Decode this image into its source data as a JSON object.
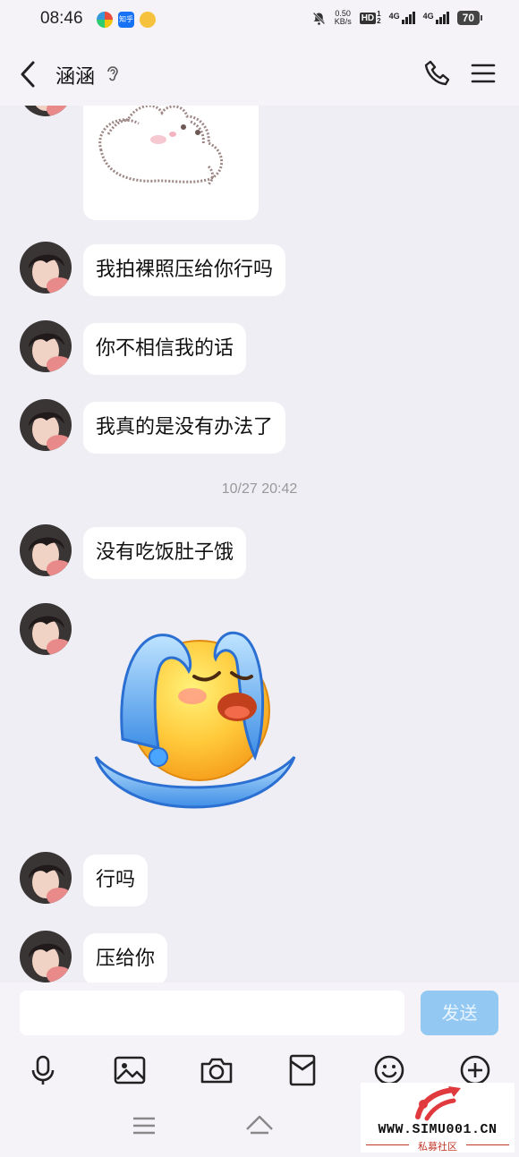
{
  "status_bar": {
    "time": "08:46",
    "net_speed_value": "0.50",
    "net_speed_unit": "KB/s",
    "hd_label": "HD",
    "hd_sup": "1",
    "hd_sub": "2",
    "signal_1": "4G",
    "signal_2": "4G",
    "battery": "70",
    "app_icons": [
      "colorful-app-icon",
      "zhihu-icon",
      "mascot-app-icon"
    ],
    "zhihu_text": "知乎"
  },
  "header": {
    "contact_name": "涵涵",
    "back_icon": "chevron-left-icon",
    "voice_icon": "ear-icon",
    "call_icon": "phone-icon",
    "menu_icon": "hamburger-menu-icon"
  },
  "chat": {
    "messages": [
      {
        "type": "sticker",
        "sticker": "bunny-sticker"
      },
      {
        "type": "text",
        "text": "我拍裸照压给你行吗"
      },
      {
        "type": "text",
        "text": "你不相信我的话"
      },
      {
        "type": "text",
        "text": "我真的是没有办法了"
      },
      {
        "type": "timestamp",
        "text": "10/27 20:42"
      },
      {
        "type": "text",
        "text": "没有吃饭肚子饿"
      },
      {
        "type": "sticker",
        "sticker": "crying-emoji-sticker"
      },
      {
        "type": "text",
        "text": "行吗"
      },
      {
        "type": "text",
        "text": "压给你"
      }
    ]
  },
  "input_bar": {
    "placeholder": "",
    "value": "",
    "send_label": "发送",
    "send_color": "#93c8f3"
  },
  "toolbar": {
    "icons": [
      "microphone-icon",
      "image-icon",
      "camera-icon",
      "red-packet-icon",
      "emoji-icon",
      "plus-icon"
    ]
  },
  "navbar": {
    "icons": [
      "nav-menu-icon",
      "nav-home-icon"
    ]
  },
  "watermark": {
    "url": "WWW.SIMU001.CN",
    "subtitle": "私募社区",
    "logo": "simu-logo-icon"
  }
}
